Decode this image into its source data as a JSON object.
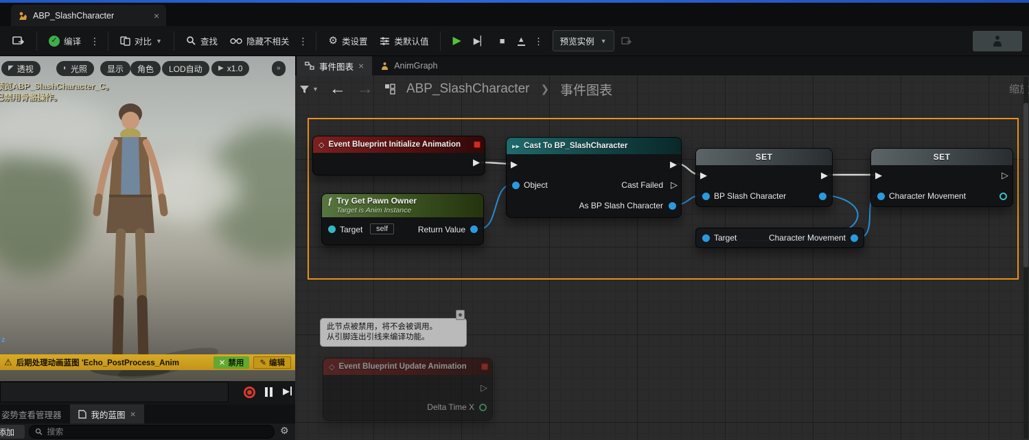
{
  "titlebar": {
    "tab_title": "ABP_SlashCharacter"
  },
  "toolbar": {
    "compile_label": "编译",
    "diff_label": "对比",
    "find_label": "查找",
    "hide_unrelated_label": "隐藏不相关",
    "class_settings_label": "类设置",
    "class_defaults_label": "类默认值",
    "preview_instance_label": "预览实例"
  },
  "viewport": {
    "pills": [
      "透视",
      "光照",
      "显示",
      "角色",
      "LOD自动",
      "x1.0"
    ],
    "overlay_line1": "预览ABP_SlashCharacter_C。",
    "overlay_line2": "已禁用骨骼操作。",
    "axis_z": "z",
    "warning": {
      "text": "后期处理动画蓝图 'Echo_PostProcess_Anim",
      "disable_label": "禁用",
      "edit_label": "编辑"
    },
    "tabs": {
      "pose_watch_manager": "姿势查看管理器",
      "my_blueprint": "我的蓝图"
    },
    "add_label": "添加",
    "search_placeholder": "搜索"
  },
  "graph": {
    "tab_event_graph": "事件图表",
    "tab_animgraph": "AnimGraph",
    "breadcrumb_root": "ABP_SlashCharacter",
    "breadcrumb_sep": "❯",
    "breadcrumb_current": "事件图表",
    "zoom_label": "缩放"
  },
  "nodes": {
    "event_init": {
      "title": "Event Blueprint Initialize Animation"
    },
    "cast": {
      "title": "Cast To BP_SlashCharacter",
      "object_pin": "Object",
      "cast_failed_pin": "Cast Failed",
      "as_pin": "As BP Slash Character"
    },
    "try_get_pawn_owner": {
      "title": "Try Get Pawn Owner",
      "subtitle": "Target is Anim Instance",
      "target_pin": "Target",
      "self_value": "self",
      "return_pin": "Return Value"
    },
    "set_bp_slash": {
      "title": "SET",
      "pin": "BP Slash Character"
    },
    "set_char_move": {
      "title": "SET",
      "pin": "Character Movement"
    },
    "get_character_movement": {
      "target_pin": "Target",
      "output_pin": "Character Movement"
    },
    "event_update": {
      "title": "Event Blueprint Update Animation",
      "delta_pin": "Delta Time X"
    },
    "disabled_tooltip_line1": "此节点被禁用，将不会被调用。",
    "disabled_tooltip_line2": "从引脚连出引线来编译功能。"
  }
}
